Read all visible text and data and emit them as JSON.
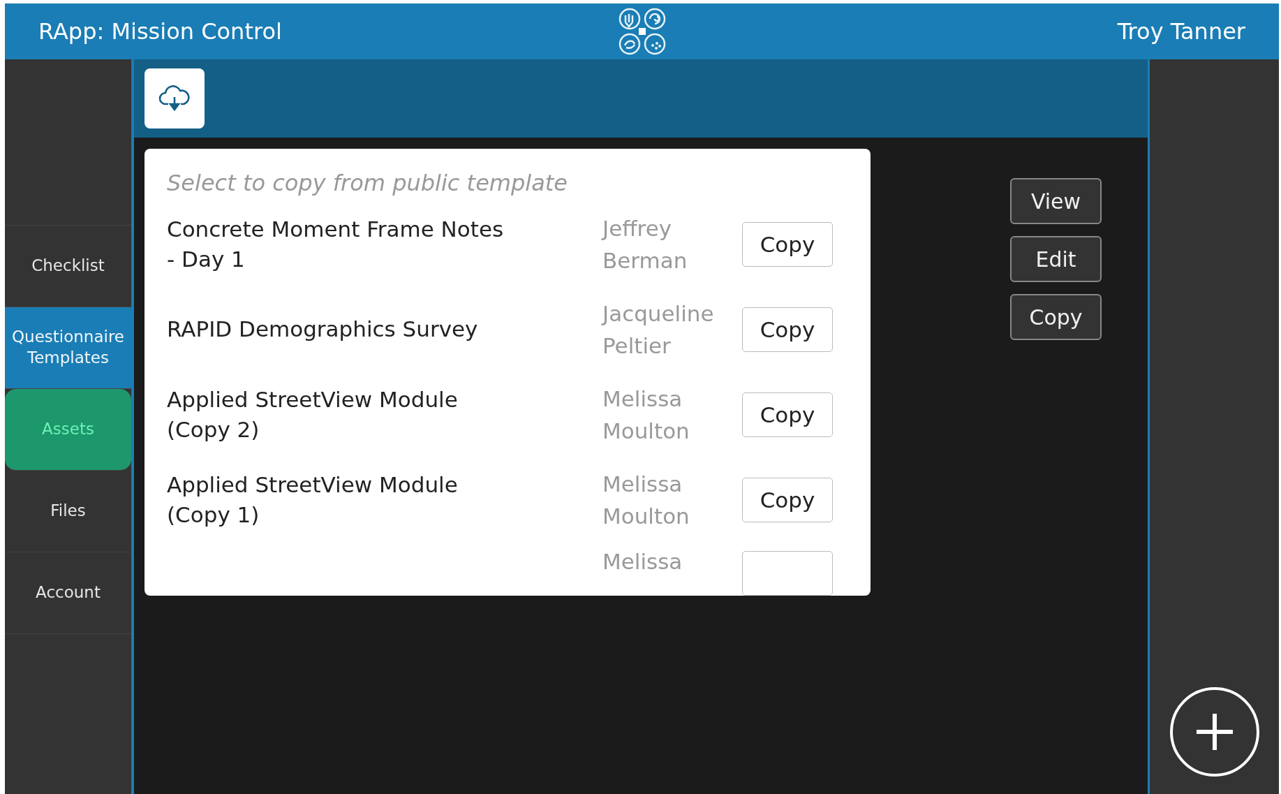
{
  "header": {
    "title": "RApp: Mission Control",
    "user": "Troy Tanner"
  },
  "sidebar": {
    "items": [
      {
        "label": "Checklist",
        "selected": false,
        "pressed": false
      },
      {
        "label": "Questionnaire Templates",
        "selected": true,
        "pressed": false
      },
      {
        "label": "Assets",
        "selected": false,
        "pressed": true
      },
      {
        "label": "Files",
        "selected": false,
        "pressed": false
      },
      {
        "label": "Account",
        "selected": false,
        "pressed": false
      }
    ]
  },
  "template_list": {
    "placeholder": "Select to copy from public template",
    "rows": [
      {
        "title": "Concrete Moment Frame Notes - Day 1",
        "author": "Jeffrey Berman",
        "button": "Copy"
      },
      {
        "title": "RAPID Demographics Survey",
        "author": "Jacqueline Peltier",
        "button": "Copy"
      },
      {
        "title": "Applied StreetView Module (Copy 2)",
        "author": "Melissa Moulton",
        "button": "Copy"
      },
      {
        "title": "Applied StreetView Module (Copy 1)",
        "author": "Melissa Moulton",
        "button": "Copy"
      },
      {
        "author": "Melissa"
      }
    ]
  },
  "actions": [
    "View",
    "Edit",
    "Copy"
  ]
}
